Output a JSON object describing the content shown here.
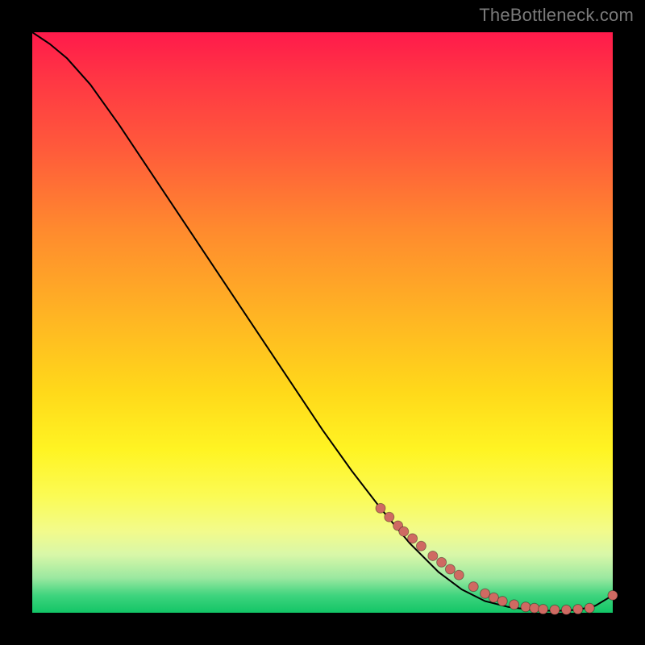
{
  "watermark": "TheBottleneck.com",
  "colors": {
    "page_bg": "#000000",
    "curve": "#000000",
    "marker": "#cf6a62",
    "watermark": "#7a7a7a"
  },
  "chart_data": {
    "type": "line",
    "title": "",
    "xlabel": "",
    "ylabel": "",
    "xlim": [
      0,
      100
    ],
    "ylim": [
      0,
      100
    ],
    "grid": false,
    "legend": false,
    "curve": {
      "x": [
        0,
        3,
        6,
        10,
        15,
        20,
        25,
        30,
        35,
        40,
        45,
        50,
        55,
        60,
        65,
        70,
        74,
        78,
        82,
        86,
        90,
        94,
        97,
        100
      ],
      "y": [
        100,
        98,
        95.5,
        91,
        84,
        76.5,
        69,
        61.5,
        54,
        46.5,
        39,
        31.5,
        24.5,
        18,
        12,
        7,
        4,
        2,
        1,
        0.5,
        0.3,
        0.5,
        1.2,
        3
      ]
    },
    "markers": {
      "x": [
        60,
        61.5,
        63,
        64,
        65.5,
        67,
        69,
        70.5,
        72,
        73.5,
        76,
        78,
        79.5,
        81,
        83,
        85,
        86.5,
        88,
        90,
        92,
        94,
        96,
        100
      ],
      "y": [
        18,
        16.5,
        15,
        14,
        12.8,
        11.5,
        9.8,
        8.7,
        7.5,
        6.5,
        4.5,
        3.3,
        2.6,
        2.0,
        1.4,
        1.0,
        0.8,
        0.6,
        0.5,
        0.5,
        0.6,
        0.8,
        3.0
      ]
    }
  }
}
